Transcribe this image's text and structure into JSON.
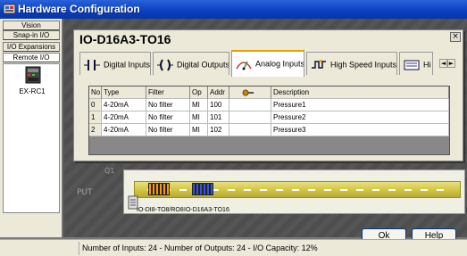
{
  "window": {
    "title": "Hardware Configuration"
  },
  "left_tabs": [
    {
      "label": "Vision",
      "active": false
    },
    {
      "label": "Snap-in I/O",
      "active": false
    },
    {
      "label": "I/O Expansions",
      "active": false
    },
    {
      "label": "Remote I/O",
      "active": true
    }
  ],
  "left_item": {
    "label": "EX-RC1",
    "icon": "plc-module-icon"
  },
  "background_labels": {
    "q1": "Q1",
    "output": "PUT"
  },
  "config": {
    "title": "IO-D16A3-TO16",
    "close": "×",
    "tabs": [
      {
        "label": "Digital Inputs",
        "icon": "digital-inputs-icon"
      },
      {
        "label": "Digital Outputs",
        "icon": "digital-outputs-icon"
      },
      {
        "label": "Analog Inputs",
        "icon": "analog-inputs-icon",
        "active": true
      },
      {
        "label": "High Speed Inputs",
        "icon": "high-speed-inputs-icon"
      },
      {
        "label": "Hi",
        "icon": "more-icon"
      }
    ],
    "scroll": {
      "left": "◄",
      "right": "►"
    },
    "grid": {
      "headers": [
        "No.",
        "Type",
        "Filter",
        "Op",
        "Addr",
        "",
        "Description"
      ],
      "rows": [
        [
          "0",
          "4-20mA",
          "No filter",
          "MI",
          "100",
          "",
          "Pressure1"
        ],
        [
          "1",
          "4-20mA",
          "No filter",
          "MI",
          "101",
          "",
          "Pressure2"
        ],
        [
          "2",
          "4-20mA",
          "No filter",
          "MI",
          "102",
          "",
          "Pressure3"
        ]
      ]
    }
  },
  "rail": {
    "module_labels": [
      "IO-DI8-TO8/RO8",
      "IO-D16A3-TO16"
    ]
  },
  "buttons": {
    "ok": "Ok",
    "help": "Help"
  },
  "status": {
    "text": "Number of Inputs: 24  - Number of Outputs: 24  - I/O Capacity: 12%"
  }
}
